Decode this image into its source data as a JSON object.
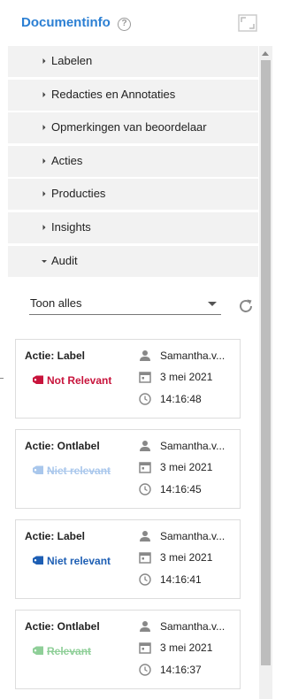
{
  "header": {
    "title": "Documentinfo",
    "help_icon": "question-icon",
    "expand_icon": "expand-icon"
  },
  "sections": [
    {
      "label": "Labelen",
      "expanded": false
    },
    {
      "label": "Redacties en Annotaties",
      "expanded": false
    },
    {
      "label": "Opmerkingen van beoordelaar",
      "expanded": false
    },
    {
      "label": "Acties",
      "expanded": false
    },
    {
      "label": "Producties",
      "expanded": false
    },
    {
      "label": "Insights",
      "expanded": false
    },
    {
      "label": "Audit",
      "expanded": true
    }
  ],
  "audit": {
    "filter_value": "Toon alles",
    "refresh_icon": "refresh-icon",
    "entries": [
      {
        "action": "Actie: Label",
        "tag": "Not Relevant",
        "tag_color": "#c8143c",
        "struck": false,
        "user": "Samantha.v...",
        "date": "3 mei 2021",
        "time": "14:16:48"
      },
      {
        "action": "Actie: Ontlabel",
        "tag": "Niet relevant",
        "tag_color": "#a9c7ec",
        "struck": true,
        "user": "Samantha.v...",
        "date": "3 mei 2021",
        "time": "14:16:45"
      },
      {
        "action": "Actie: Label",
        "tag": "Niet relevant",
        "tag_color": "#1e5fb4",
        "struck": false,
        "user": "Samantha.v...",
        "date": "3 mei 2021",
        "time": "14:16:41"
      },
      {
        "action": "Actie: Ontlabel",
        "tag": "Relevant",
        "tag_color": "#8fcf98",
        "struck": true,
        "user": "Samantha.v...",
        "date": "3 mei 2021",
        "time": "14:16:37"
      }
    ]
  },
  "colors": {
    "accent": "#2b7fd3",
    "section_bg": "#f2f2f2",
    "scroll_thumb": "#bdbdbd"
  }
}
